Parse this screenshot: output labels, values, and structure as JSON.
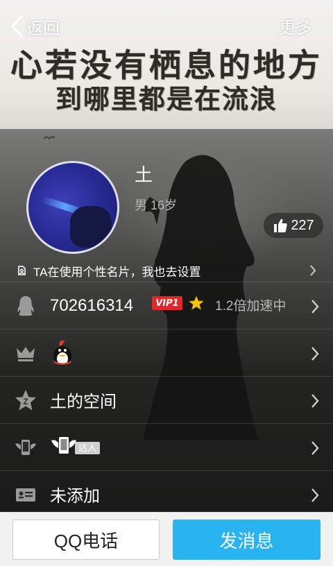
{
  "topbar": {
    "back_label": "返回",
    "more_label": "更多"
  },
  "cover": {
    "line1": "心若没有栖息的地方",
    "line2": "到哪里都是在流浪"
  },
  "profile": {
    "nickname": "土",
    "gender_age": "男  16岁",
    "likes": "227"
  },
  "card_banner": {
    "text": "TA在使用个性名片，我也去设置"
  },
  "rows": {
    "qq_number": "702616314",
    "vip_label": "VIP1",
    "speed_text": "1.2倍加速中",
    "space_label": "土的空间",
    "daren_tag": "达人",
    "tag_label": "未添加"
  },
  "bottom": {
    "call_label": "QQ电话",
    "message_label": "发消息"
  },
  "colors": {
    "accent": "#29b4f1",
    "vip_red": "#e4262a"
  }
}
